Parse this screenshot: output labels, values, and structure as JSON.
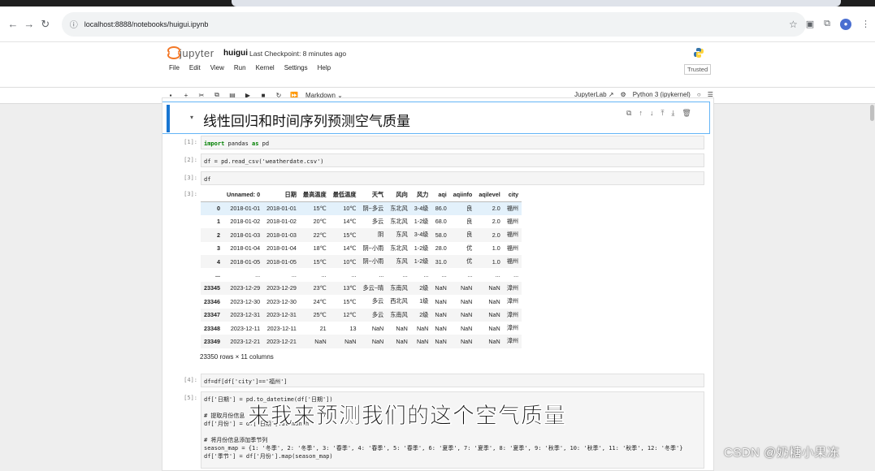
{
  "browser": {
    "url": "localhost:8888/notebooks/huigui.ipynb"
  },
  "jupyter": {
    "logo_text": "jupyter",
    "notebook_name": "huigui",
    "checkpoint": "Last Checkpoint: 8 minutes ago",
    "menu": [
      "File",
      "Edit",
      "View",
      "Run",
      "Kernel",
      "Settings",
      "Help"
    ],
    "trusted": "Trusted",
    "cell_type": "Markdown",
    "jupyterlab": "JupyterLab",
    "kernel": "Python 3 (ipykernel)"
  },
  "markdown_heading": "线性回归和时间序列预测空气质量",
  "cells": [
    {
      "prompt": "[1]:",
      "code": "import pandas as pd"
    },
    {
      "prompt": "[2]:",
      "code": "df = pd.read_csv('weatherdate.csv')"
    },
    {
      "prompt": "[3]:",
      "code": "df"
    },
    {
      "prompt": "[4]:",
      "code": "df=df[df['city']=='福州']"
    },
    {
      "prompt": "[5]:",
      "code": "df['日期'] = pd.to_datetime(df['日期'])\n\n# 提取月份信息\ndf['月份'] = df['日期'].dt.month\n\n# 将月份信息添加季节列\nseason_map = {1: '冬季', 2: '冬季', 3: '春季', 4: '春季', 5: '春季', 6: '夏季', 7: '夏季', 8: '夏季', 9: '秋季', 10: '秋季', 11: '秋季', 12: '冬季'}\ndf['季节'] = df['月份'].map(season_map)"
    }
  ],
  "output_prompt": "[3]:",
  "dataframe": {
    "columns": [
      "Unnamed: 0",
      "日期",
      "最高温度",
      "最低温度",
      "天气",
      "风向",
      "风力",
      "aqi",
      "aqiinfo",
      "aqilevel",
      "city"
    ],
    "rows": [
      [
        "0",
        "2018-01-01",
        "2018-01-01",
        "15℃",
        "10℃",
        "阴~多云",
        "东北风",
        "3-4级",
        "86.0",
        "良",
        "2.0",
        "福州"
      ],
      [
        "1",
        "2018-01-02",
        "2018-01-02",
        "20℃",
        "14℃",
        "多云",
        "东北风",
        "1-2级",
        "68.0",
        "良",
        "2.0",
        "福州"
      ],
      [
        "2",
        "2018-01-03",
        "2018-01-03",
        "22℃",
        "15℃",
        "阴",
        "东风",
        "3-4级",
        "58.0",
        "良",
        "2.0",
        "福州"
      ],
      [
        "3",
        "2018-01-04",
        "2018-01-04",
        "18℃",
        "14℃",
        "阴~小雨",
        "东北风",
        "1-2级",
        "28.0",
        "优",
        "1.0",
        "福州"
      ],
      [
        "4",
        "2018-01-05",
        "2018-01-05",
        "15℃",
        "10℃",
        "阴~小雨",
        "东风",
        "1-2级",
        "31.0",
        "优",
        "1.0",
        "福州"
      ],
      [
        "...",
        "...",
        "...",
        "...",
        "...",
        "...",
        "...",
        "...",
        "...",
        "...",
        "...",
        "..."
      ],
      [
        "23345",
        "2023-12-29",
        "2023-12-29",
        "23℃",
        "13℃",
        "多云~晴",
        "东南风",
        "2级",
        "NaN",
        "NaN",
        "NaN",
        "漳州"
      ],
      [
        "23346",
        "2023-12-30",
        "2023-12-30",
        "24℃",
        "15℃",
        "多云",
        "西北风",
        "1级",
        "NaN",
        "NaN",
        "NaN",
        "漳州"
      ],
      [
        "23347",
        "2023-12-31",
        "2023-12-31",
        "25℃",
        "12℃",
        "多云",
        "东南风",
        "2级",
        "NaN",
        "NaN",
        "NaN",
        "漳州"
      ],
      [
        "23348",
        "2023-12-11",
        "2023-12-11",
        "21",
        "13",
        "NaN",
        "NaN",
        "NaN",
        "NaN",
        "NaN",
        "NaN",
        "漳州"
      ],
      [
        "23349",
        "2023-12-21",
        "2023-12-21",
        "NaN",
        "NaN",
        "NaN",
        "NaN",
        "NaN",
        "NaN",
        "NaN",
        "NaN",
        "漳州"
      ]
    ],
    "shape": "23350 rows × 11 columns"
  },
  "subtitle": "来我来预测我们的这个空气质量",
  "watermark": "CSDN @奶糖小果冻",
  "colors": {
    "accent": "#1976d2",
    "jupyter_orange": "#f37726",
    "selected_border": "#64b5f6"
  }
}
